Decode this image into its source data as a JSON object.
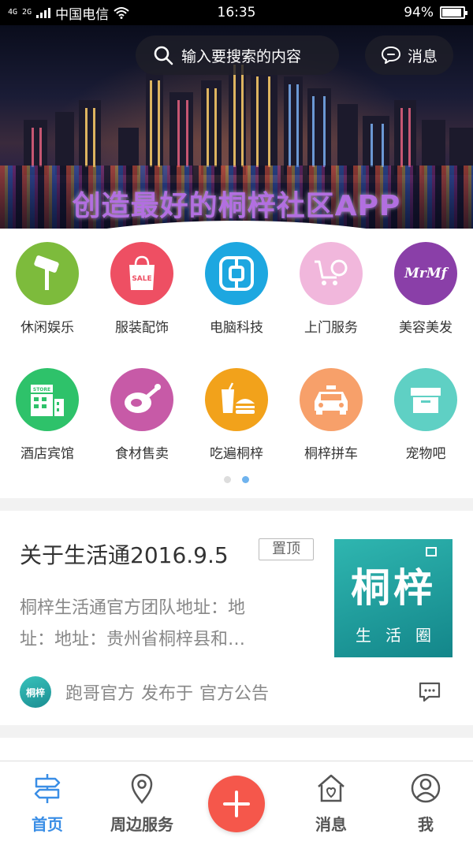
{
  "status_bar": {
    "network": "4G 2G",
    "carrier": "中国电信",
    "time": "16:35",
    "battery": "94%",
    "battery_level": 0.94
  },
  "header": {
    "search_placeholder": "输入要搜索的内容",
    "messages_label": "消息"
  },
  "banner": {
    "slogan": "创造最好的桐梓社区APP"
  },
  "categories": [
    {
      "label": "休闲娱乐",
      "icon": "microphone-icon",
      "color": "#7dbb3c"
    },
    {
      "label": "服装配饰",
      "icon": "shopping-bag-icon",
      "color": "#ee4f63",
      "badge": "SALE"
    },
    {
      "label": "电脑科技",
      "icon": "tech-icon",
      "color": "#1da7e0"
    },
    {
      "label": "上门服务",
      "icon": "cart-icon",
      "color": "#f1b7dc"
    },
    {
      "label": "美容美发",
      "icon": "beauty-logo-icon",
      "color": "#8a3fa8",
      "badge": "MrMf"
    },
    {
      "label": "酒店宾馆",
      "icon": "hotel-icon",
      "color": "#2ec26a",
      "badge": "STORE"
    },
    {
      "label": "食材售卖",
      "icon": "meat-icon",
      "color": "#c75aa7"
    },
    {
      "label": "吃遍桐梓",
      "icon": "fast-food-icon",
      "color": "#f2a21b"
    },
    {
      "label": "桐梓拼车",
      "icon": "taxi-icon",
      "color": "#f7a06a"
    },
    {
      "label": "宠物吧",
      "icon": "box-icon",
      "color": "#5fd0c4"
    }
  ],
  "pager": {
    "pages": 2,
    "active": 1
  },
  "post": {
    "title": "关于生活通2016.9.5",
    "pinned_label": "置顶",
    "excerpt_line1": "桐梓生活通官方团队地址：地",
    "excerpt_line2": "址：地址：贵州省桐梓县和…",
    "author": "跑哥官方",
    "published_in": "发布于",
    "channel": "官方公告",
    "avatar_text": "桐梓",
    "thumb_title": "桐梓",
    "thumb_subtitle": "生活圈"
  },
  "bottom_nav": [
    {
      "label": "首页",
      "icon": "signpost-icon",
      "active": true
    },
    {
      "label": "周边服务",
      "icon": "location-pin-icon",
      "active": false
    },
    {
      "label": "消息",
      "icon": "house-heart-icon",
      "active": false
    },
    {
      "label": "我",
      "icon": "user-icon",
      "active": false
    }
  ],
  "colors": {
    "accent": "#3a8ee6",
    "add_button": "#f5574b"
  }
}
